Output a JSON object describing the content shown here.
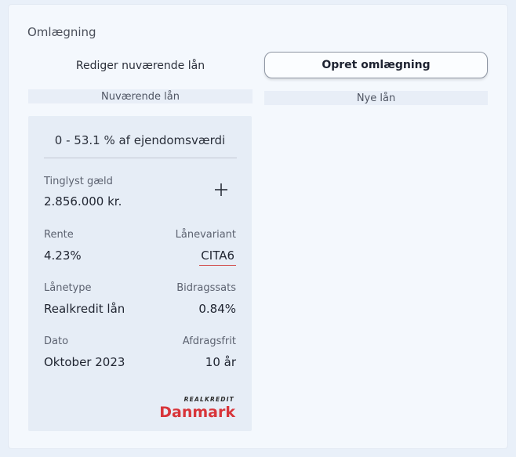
{
  "panel": {
    "title": "Omlægning"
  },
  "actions": {
    "edit_label": "Rediger nuværende lån",
    "create_label": "Opret omlægning"
  },
  "columns": {
    "current_header": "Nuværende lån",
    "new_header": "Nye lån"
  },
  "loan": {
    "range": "0 - 53.1 % af ejendomsværdi",
    "debt_label": "Tinglyst gæld",
    "debt_value": "2.856.000 kr.",
    "rate_label": "Rente",
    "rate_value": "4.23%",
    "variant_label": "Lånevariant",
    "variant_value": "CITA6",
    "type_label": "Lånetype",
    "type_value": "Realkredit lån",
    "fee_label": "Bidragssats",
    "fee_value": "0.84%",
    "date_label": "Dato",
    "date_value": "Oktober 2023",
    "io_label": "Afdragsfrit",
    "io_value": "10 år",
    "lender_logo_top": "REALKREDIT",
    "lender_logo_main": "Danmark"
  },
  "colors": {
    "accent_red": "#d14a4a",
    "logo_red": "#d8353a",
    "card_bg": "#e6edf6"
  },
  "icons": {
    "add": "plus-icon"
  }
}
